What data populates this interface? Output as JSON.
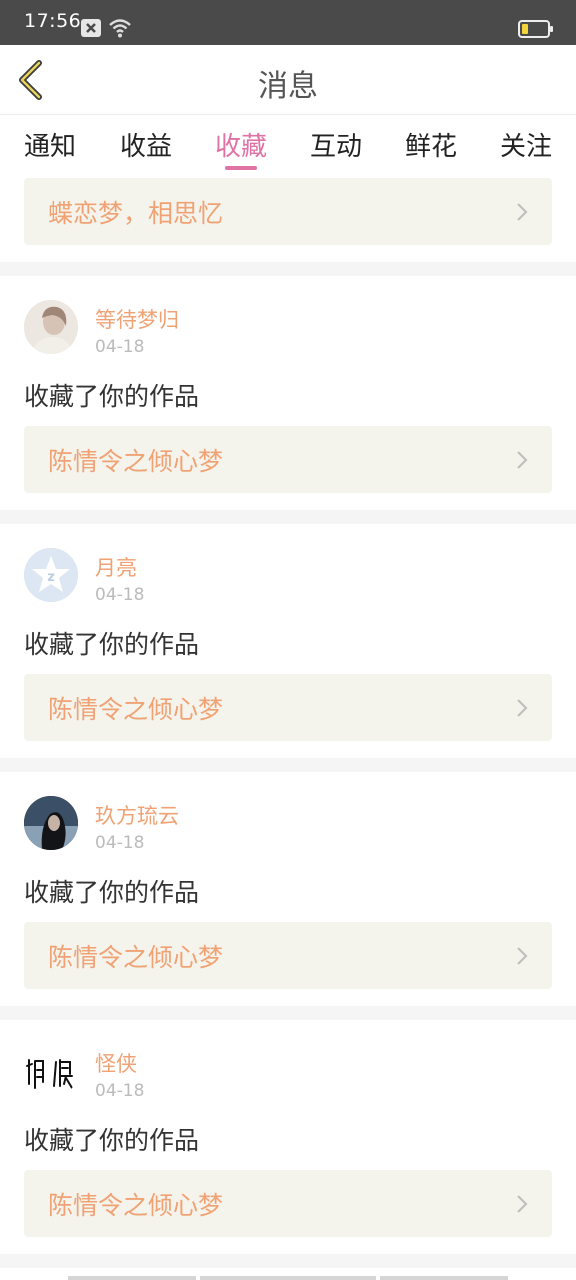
{
  "status_bar": {
    "time": "17:56"
  },
  "header": {
    "title": "消息"
  },
  "tabs": [
    {
      "label": "通知"
    },
    {
      "label": "收益"
    },
    {
      "label": "收藏"
    },
    {
      "label": "互动"
    },
    {
      "label": "鲜花"
    },
    {
      "label": "关注"
    }
  ],
  "active_tab": "收藏",
  "accent_colors": {
    "active_tab": "#e073a5",
    "highlight_text": "#f0a274"
  },
  "top_partial_item": {
    "work_title": "蝶恋梦，相思忆"
  },
  "items": [
    {
      "user": "等待梦归",
      "date": "04-18",
      "action": "收藏了你的作品",
      "work_title": "陈情令之倾心梦"
    },
    {
      "user": "月亮",
      "date": "04-18",
      "action": "收藏了你的作品",
      "work_title": "陈情令之倾心梦"
    },
    {
      "user": "玖方琉云",
      "date": "04-18",
      "action": "收藏了你的作品",
      "work_title": "陈情令之倾心梦"
    },
    {
      "user": "怪侠",
      "date": "04-18",
      "action": "收藏了你的作品",
      "work_title": "陈情令之倾心梦"
    }
  ]
}
